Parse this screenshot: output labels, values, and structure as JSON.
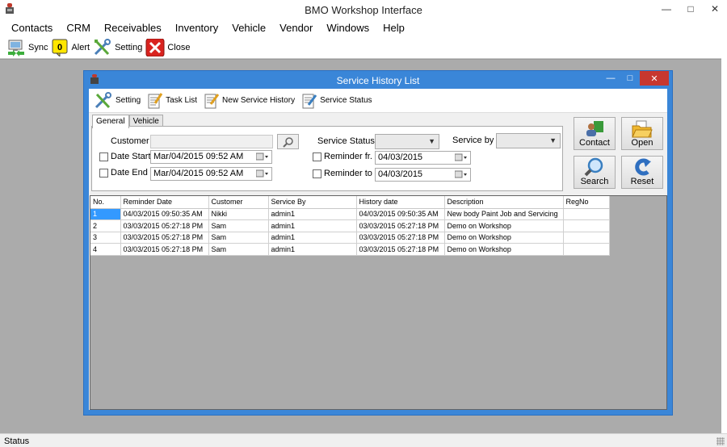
{
  "app": {
    "title": "BMO Workshop Interface",
    "menu": [
      "Contacts",
      "CRM",
      "Receivables",
      "Inventory",
      "Vehicle",
      "Vendor",
      "Windows",
      "Help"
    ],
    "toolbar": {
      "sync": "Sync",
      "alert_count": "0",
      "alert": "Alert",
      "setting": "Setting",
      "close": "Close"
    },
    "status": "Status"
  },
  "child": {
    "title": "Service History List",
    "toolbar": {
      "setting": "Setting",
      "task_list": "Task List",
      "new_service_history": "New Service History",
      "service_status": "Service Status"
    },
    "tabs": {
      "general": "General",
      "vehicle": "Vehicle"
    },
    "filters": {
      "customer_label": "Customer",
      "customer_value": "",
      "date_start_label": "Date Start",
      "date_start_value": "Mar/04/2015 09:52 AM",
      "date_end_label": "Date End",
      "date_end_value": "Mar/04/2015 09:52 AM",
      "service_status_label": "Service Status",
      "service_status_value": "",
      "service_by_label": "Service by",
      "service_by_value": "",
      "reminder_from_label": "Reminder fr.",
      "reminder_from_value": "04/03/2015",
      "reminder_to_label": "Reminder to",
      "reminder_to_value": "04/03/2015"
    },
    "actions": {
      "contact": "Contact",
      "open": "Open",
      "search": "Search",
      "reset": "Reset"
    },
    "table": {
      "columns": [
        "No.",
        "Reminder Date",
        "Customer",
        "Service By",
        "History date",
        "Description",
        "RegNo"
      ],
      "rows": [
        [
          "1",
          "04/03/2015 09:50:35 AM",
          "Nikki",
          "admin1",
          "04/03/2015 09:50:35 AM",
          "New body Paint Job and Servicing",
          ""
        ],
        [
          "2",
          "03/03/2015 05:27:18 PM",
          "Sam",
          "admin1",
          "03/03/2015 05:27:18 PM",
          "Demo on Workshop",
          ""
        ],
        [
          "3",
          "03/03/2015 05:27:18 PM",
          "Sam",
          "admin1",
          "03/03/2015 05:27:18 PM",
          "Demo on Workshop",
          ""
        ],
        [
          "4",
          "03/03/2015 05:27:18 PM",
          "Sam",
          "admin1",
          "03/03/2015 05:27:18 PM",
          "Demo on Workshop",
          ""
        ]
      ]
    }
  },
  "colors": {
    "child_titlebar": "#3a86d8",
    "close_red": "#c7372f",
    "selected_cell": "#3399ff"
  }
}
